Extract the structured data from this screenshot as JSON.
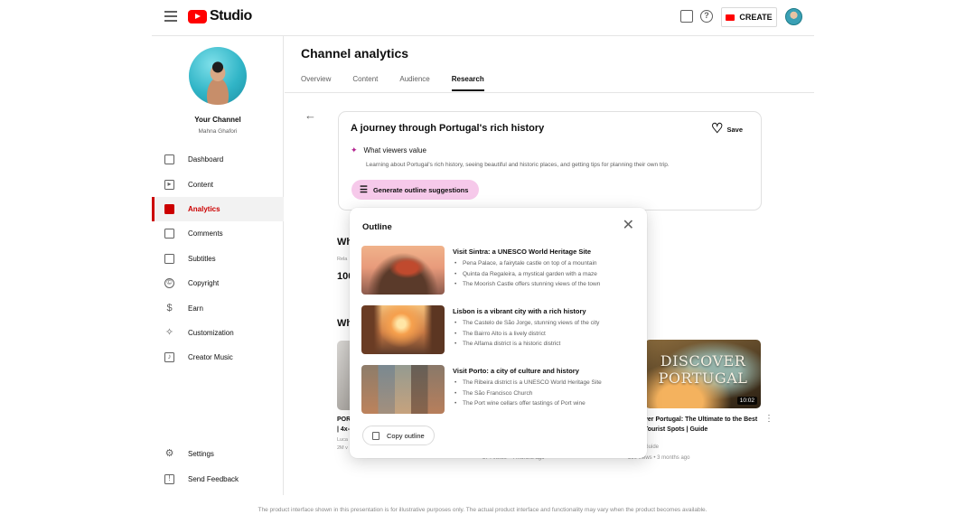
{
  "app": {
    "logo_text": "Studio",
    "brand_color": "#ff0000",
    "accent_pink": "#f6c9ea"
  },
  "header": {
    "create_label": "CREATE",
    "icons": [
      "menu-icon",
      "feedback-icon",
      "help-icon",
      "camera-icon",
      "account-avatar"
    ]
  },
  "channel": {
    "name": "Your Channel",
    "handle": "Mahna Ghafori"
  },
  "sidebar": {
    "items": [
      {
        "label": "Dashboard",
        "icon": "dashboard-icon"
      },
      {
        "label": "Content",
        "icon": "content-icon"
      },
      {
        "label": "Analytics",
        "icon": "analytics-icon",
        "active": true
      },
      {
        "label": "Comments",
        "icon": "comments-icon"
      },
      {
        "label": "Subtitles",
        "icon": "subtitles-icon"
      },
      {
        "label": "Copyright",
        "icon": "copyright-icon"
      },
      {
        "label": "Earn",
        "icon": "earn-icon"
      },
      {
        "label": "Customization",
        "icon": "customization-icon"
      },
      {
        "label": "Creator Music",
        "icon": "music-icon"
      }
    ],
    "bottom": [
      {
        "label": "Settings",
        "icon": "settings-icon"
      },
      {
        "label": "Send Feedback",
        "icon": "feedback-icon"
      }
    ]
  },
  "main": {
    "title": "Channel analytics",
    "tabs": [
      {
        "label": "Overview"
      },
      {
        "label": "Content"
      },
      {
        "label": "Audience"
      },
      {
        "label": "Research",
        "active": true
      }
    ],
    "topic": {
      "title": "A journey through Portugal's rich history",
      "save_label": "Save",
      "value_heading": "What viewers value",
      "value_desc": "Learning about Portugal's rich history, seeing beautiful and historic places, and getting tips for planning their own trip.",
      "generate_label": "Generate outline suggestions"
    },
    "background": {
      "heading1_partial": "Wh",
      "small_partial": "Rela",
      "number_partial": "100",
      "heading2_partial": "Wh",
      "left_video_title_lines": [
        "POR",
        "| 4x-"
      ],
      "left_video_meta_lines": [
        "Luca",
        "2M v"
      ],
      "mid_meta": "374 views • 4 months ago",
      "right_video": {
        "thumb_text_line1": "DISCOVER",
        "thumb_text_line2": "PORTUGAL",
        "duration": "10:02",
        "title": "ver Portugal: The Ultimate to the Best Tourist Spots | Guide",
        "channel_partial": "Guide",
        "meta": "390 views • 3 months ago"
      }
    }
  },
  "outline": {
    "title": "Outline",
    "items": [
      {
        "heading": "Visit Sintra: a UNESCO World Heritage Site",
        "bullets": [
          "Pena Palace, a fairytale castle on top of a mountain",
          "Quinta da Regaleira, a mystical garden with a maze",
          "The Moorish Castle offers stunning views of the town"
        ]
      },
      {
        "heading": "Lisbon is a vibrant city with a rich history",
        "bullets": [
          "The Castelo de São Jorge, stunning views of the city",
          "The Bairro Alto is a lively district",
          "The Alfama district is a historic district"
        ]
      },
      {
        "heading": "Visit Porto: a city of culture and history",
        "bullets": [
          "The Ribeira district is a UNESCO World Heritage Site",
          "The São Francisco Church",
          "The Port wine cellars offer tastings of Port wine"
        ]
      }
    ],
    "copy_label": "Copy outline"
  },
  "disclaimer": "The product interface shown in this presentation is for illustrative purposes only. The actual product interface and functionality may vary when the product becomes available."
}
